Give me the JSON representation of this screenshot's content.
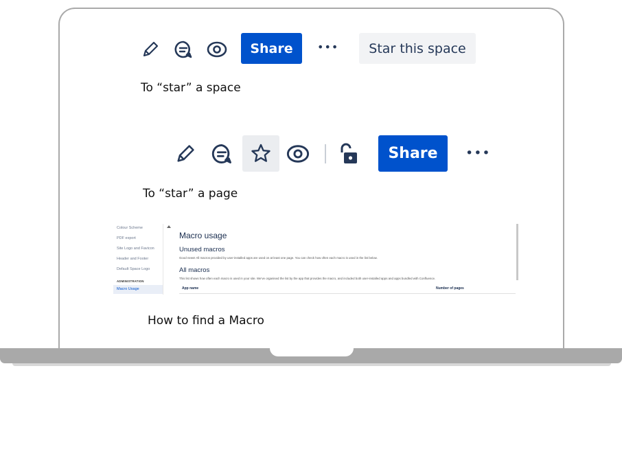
{
  "space_toolbar": {
    "share_label": "Share",
    "more_label": "•••",
    "star_space_label": "Star this space",
    "icons": [
      "pencil-icon",
      "comment-icon",
      "eye-icon"
    ]
  },
  "captions": {
    "star_space": "To “star” a space",
    "star_page": "To “star” a page",
    "find_macro": "How to find a Macro"
  },
  "page_toolbar": {
    "share_label": "Share",
    "more_label": "•••",
    "icons": [
      "pencil-icon",
      "comment-icon",
      "star-icon",
      "eye-icon",
      "unlock-icon"
    ]
  },
  "colors": {
    "share_button": "#0052cc",
    "icon": "#253858",
    "star_space_bg": "#f2f3f5"
  },
  "macro_screenshot": {
    "sidebar": {
      "items": [
        "Colour Scheme",
        "PDF export",
        "Site Logo and Favicon",
        "Header and Footer",
        "Default Space Logo"
      ],
      "section_heading": "ADMINISTRATION",
      "active_item": "Macro Usage"
    },
    "title": "Macro usage",
    "unused_heading": "Unused macros",
    "unused_text": "Good news! All macros provided by user-installed apps are used on at least one page. You can check how often each macro is used in the list below.",
    "all_heading": "All macros",
    "all_text": "This list shows how often each macro is used in your site. We've organised the list by the app that provides the macro, and included both user-installed apps and apps bundled with Confluence.",
    "col_app_name": "App name",
    "col_pages": "Number of pages"
  }
}
